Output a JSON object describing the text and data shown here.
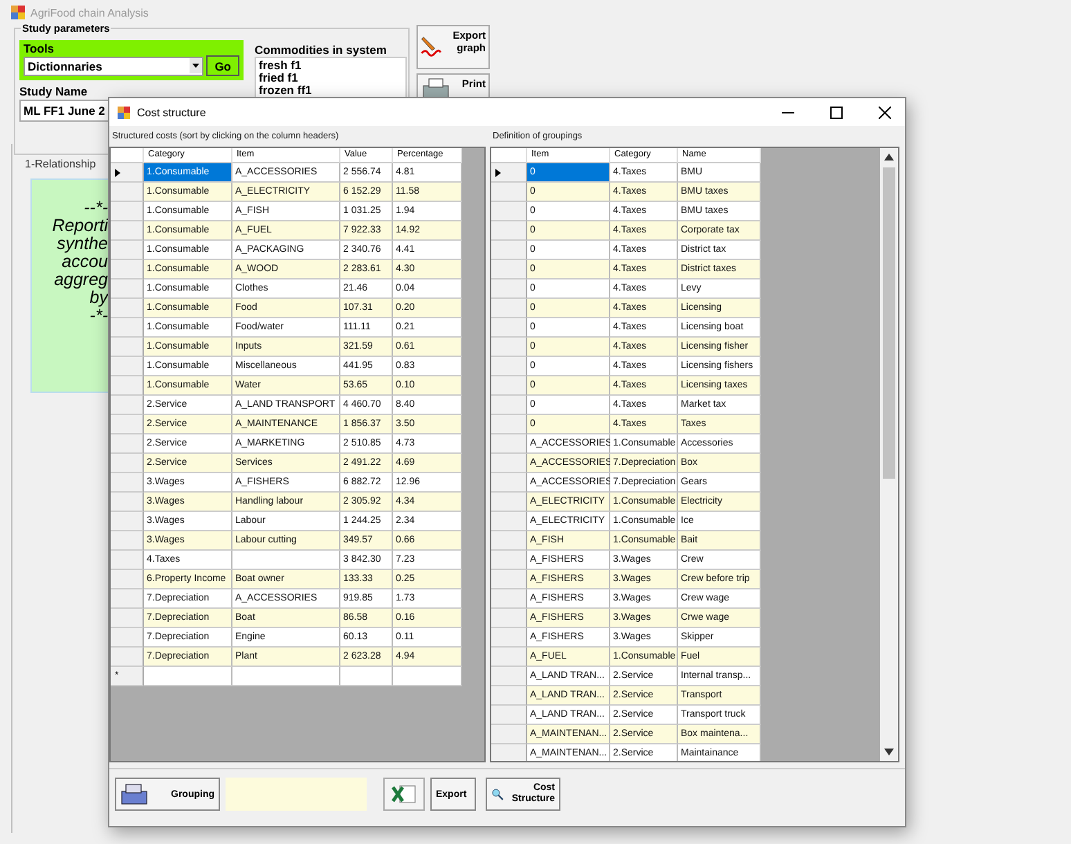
{
  "app": {
    "title": "AgriFood chain Analysis"
  },
  "study_parameters": {
    "title": "Study parameters",
    "tools": {
      "label": "Tools",
      "selection": "Dictionnaries",
      "go_button": "Go"
    },
    "study_name": {
      "label": "Study Name",
      "value": "ML FF1 June 2"
    },
    "commodities": {
      "label": "Commodities in system",
      "items": [
        "fresh f1",
        "fried f1",
        "frozen ff1"
      ]
    }
  },
  "side_buttons": [
    {
      "kind": "export",
      "label": "Export graph"
    },
    {
      "kind": "print",
      "label": "Print"
    }
  ],
  "tab": {
    "label": "1-Relationship"
  },
  "note": {
    "lines": [
      "--*-",
      "Reporti",
      "synthe",
      "accou",
      "aggreg",
      "by",
      "-*-"
    ]
  },
  "dialog": {
    "title": "Cost structure",
    "structured_costs": {
      "caption": "Structured costs (sort by clicking on the column headers)",
      "columns": [
        "Category",
        "Item",
        "Value",
        "Percentage"
      ],
      "new_row_marker": "*",
      "rows": [
        {
          "category": "1.Consumable",
          "item": "A_ACCESSORIES",
          "value": "2 556.74",
          "percentage": "4.81",
          "selected": true
        },
        {
          "category": "1.Consumable",
          "item": "A_ELECTRICITY",
          "value": "6 152.29",
          "percentage": "11.58",
          "selected": false
        },
        {
          "category": "1.Consumable",
          "item": "A_FISH",
          "value": "1 031.25",
          "percentage": "1.94",
          "selected": false
        },
        {
          "category": "1.Consumable",
          "item": "A_FUEL",
          "value": "7 922.33",
          "percentage": "14.92",
          "selected": false
        },
        {
          "category": "1.Consumable",
          "item": "A_PACKAGING",
          "value": "2 340.76",
          "percentage": "4.41",
          "selected": false
        },
        {
          "category": "1.Consumable",
          "item": "A_WOOD",
          "value": "2 283.61",
          "percentage": "4.30",
          "selected": false
        },
        {
          "category": "1.Consumable",
          "item": "Clothes",
          "value": "21.46",
          "percentage": "0.04",
          "selected": false
        },
        {
          "category": "1.Consumable",
          "item": "Food",
          "value": "107.31",
          "percentage": "0.20",
          "selected": false
        },
        {
          "category": "1.Consumable",
          "item": "Food/water",
          "value": "111.11",
          "percentage": "0.21",
          "selected": false
        },
        {
          "category": "1.Consumable",
          "item": "Inputs",
          "value": "321.59",
          "percentage": "0.61",
          "selected": false
        },
        {
          "category": "1.Consumable",
          "item": "Miscellaneous",
          "value": "441.95",
          "percentage": "0.83",
          "selected": false
        },
        {
          "category": "1.Consumable",
          "item": "Water",
          "value": "53.65",
          "percentage": "0.10",
          "selected": false
        },
        {
          "category": "2.Service",
          "item": "A_LAND TRANSPORT",
          "value": "4 460.70",
          "percentage": "8.40",
          "selected": false
        },
        {
          "category": "2.Service",
          "item": "A_MAINTENANCE",
          "value": "1 856.37",
          "percentage": "3.50",
          "selected": false
        },
        {
          "category": "2.Service",
          "item": "A_MARKETING",
          "value": "2 510.85",
          "percentage": "4.73",
          "selected": false
        },
        {
          "category": "2.Service",
          "item": "Services",
          "value": "2 491.22",
          "percentage": "4.69",
          "selected": false
        },
        {
          "category": "3.Wages",
          "item": "A_FISHERS",
          "value": "6 882.72",
          "percentage": "12.96",
          "selected": false
        },
        {
          "category": "3.Wages",
          "item": "Handling labour",
          "value": "2 305.92",
          "percentage": "4.34",
          "selected": false
        },
        {
          "category": "3.Wages",
          "item": "Labour",
          "value": "1 244.25",
          "percentage": "2.34",
          "selected": false
        },
        {
          "category": "3.Wages",
          "item": "Labour cutting",
          "value": "349.57",
          "percentage": "0.66",
          "selected": false
        },
        {
          "category": "4.Taxes",
          "value": "3 842.30",
          "percentage": "7.23",
          "selected": false
        },
        {
          "category": "6.Property Income",
          "item": "Boat owner",
          "value": "133.33",
          "percentage": "0.25",
          "selected": false
        },
        {
          "category": "7.Depreciation",
          "item": "A_ACCESSORIES",
          "value": "919.85",
          "percentage": "1.73",
          "selected": false
        },
        {
          "category": "7.Depreciation",
          "item": "Boat",
          "value": "86.58",
          "percentage": "0.16",
          "selected": false
        },
        {
          "category": "7.Depreciation",
          "item": "Engine",
          "value": "60.13",
          "percentage": "0.11",
          "selected": false
        },
        {
          "category": "7.Depreciation",
          "item": "Plant",
          "value": "2 623.28",
          "percentage": "4.94",
          "selected": false
        }
      ]
    },
    "groupings": {
      "caption": "Definition of groupings",
      "columns": [
        "Item",
        "Category",
        "Name"
      ],
      "rows": [
        {
          "item": "0",
          "category": "4.Taxes",
          "name": "BMU",
          "selected": true
        },
        {
          "item": "0",
          "category": "4.Taxes",
          "name": "BMU  taxes",
          "selected": false
        },
        {
          "item": "0",
          "category": "4.Taxes",
          "name": "BMU taxes",
          "selected": false
        },
        {
          "item": "0",
          "category": "4.Taxes",
          "name": "Corporate tax",
          "selected": false
        },
        {
          "item": "0",
          "category": "4.Taxes",
          "name": "District tax",
          "selected": false
        },
        {
          "item": "0",
          "category": "4.Taxes",
          "name": "District taxes",
          "selected": false
        },
        {
          "item": "0",
          "category": "4.Taxes",
          "name": "Levy",
          "selected": false
        },
        {
          "item": "0",
          "category": "4.Taxes",
          "name": "Licensing",
          "selected": false
        },
        {
          "item": "0",
          "category": "4.Taxes",
          "name": "Licensing boat",
          "selected": false
        },
        {
          "item": "0",
          "category": "4.Taxes",
          "name": "Licensing fisher",
          "selected": false
        },
        {
          "item": "0",
          "category": "4.Taxes",
          "name": "Licensing fishers",
          "selected": false
        },
        {
          "item": "0",
          "category": "4.Taxes",
          "name": "Licensing taxes",
          "selected": false
        },
        {
          "item": "0",
          "category": "4.Taxes",
          "name": "Market tax",
          "selected": false
        },
        {
          "item": "0",
          "category": "4.Taxes",
          "name": "Taxes",
          "selected": false
        },
        {
          "item": "A_ACCESSORIES",
          "category": "1.Consumable",
          "name": "Accessories",
          "selected": false
        },
        {
          "item": "A_ACCESSORIES",
          "category": "7.Depreciation",
          "name": "Box",
          "selected": false
        },
        {
          "item": "A_ACCESSORIES",
          "category": "7.Depreciation",
          "name": "Gears",
          "selected": false
        },
        {
          "item": "A_ELECTRICITY",
          "category": "1.Consumable",
          "name": "Electricity",
          "selected": false
        },
        {
          "item": "A_ELECTRICITY",
          "category": "1.Consumable",
          "name": "Ice",
          "selected": false
        },
        {
          "item": "A_FISH",
          "category": "1.Consumable",
          "name": "Bait",
          "selected": false
        },
        {
          "item": "A_FISHERS",
          "category": "3.Wages",
          "name": "Crew",
          "selected": false
        },
        {
          "item": "A_FISHERS",
          "category": "3.Wages",
          "name": "Crew before trip",
          "selected": false
        },
        {
          "item": "A_FISHERS",
          "category": "3.Wages",
          "name": "Crew wage",
          "selected": false
        },
        {
          "item": "A_FISHERS",
          "category": "3.Wages",
          "name": "Crwe wage",
          "selected": false
        },
        {
          "item": "A_FISHERS",
          "category": "3.Wages",
          "name": "Skipper",
          "selected": false
        },
        {
          "item": "A_FUEL",
          "category": "1.Consumable",
          "name": "Fuel",
          "selected": false
        },
        {
          "item": "A_LAND TRAN...",
          "category": "2.Service",
          "name": "Internal transp...",
          "selected": false
        },
        {
          "item": "A_LAND TRAN...",
          "category": "2.Service",
          "name": "Transport",
          "selected": false
        },
        {
          "item": "A_LAND TRAN...",
          "category": "2.Service",
          "name": "Transport truck",
          "selected": false
        },
        {
          "item": "A_MAINTENAN...",
          "category": "2.Service",
          "name": "Box maintena...",
          "selected": false
        },
        {
          "item": "A_MAINTENAN...",
          "category": "2.Service",
          "name": "Maintainance",
          "selected": false
        }
      ]
    },
    "footer": {
      "grouping_button": "Grouping",
      "export_button": "Export",
      "cost_structure_button": "Cost Structure"
    }
  }
}
